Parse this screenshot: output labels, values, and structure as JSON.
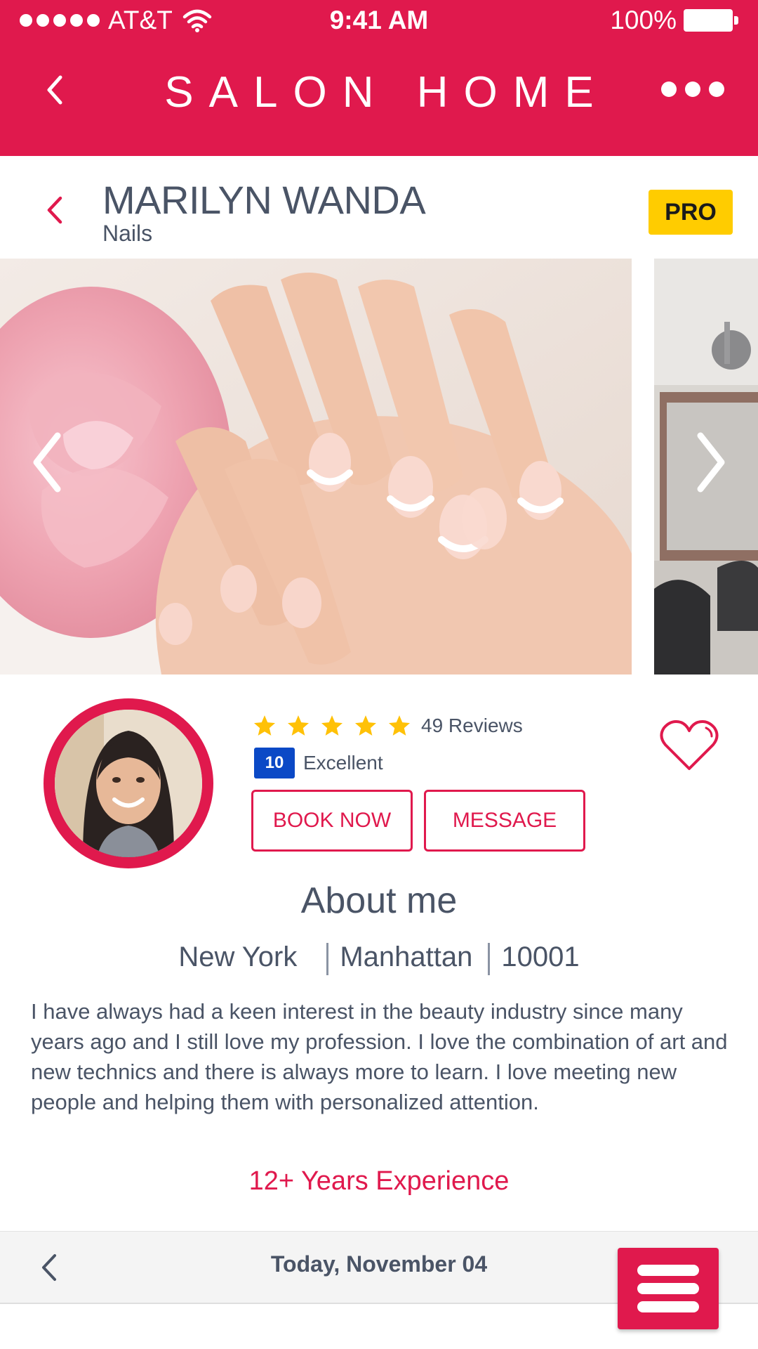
{
  "status_bar": {
    "carrier": "AT&T",
    "time": "9:41 AM",
    "battery": "100%"
  },
  "header": {
    "brand": "SALON HOME",
    "back_icon": "chevron-left-icon",
    "more_icon": "more-dots-icon"
  },
  "profile": {
    "name": "MARILYN WANDA",
    "category": "Nails",
    "badge": "PRO",
    "rating_stars": 5,
    "reviews": "49 Reviews",
    "score": "10",
    "score_label": "Excellent",
    "book_label": "BOOK NOW",
    "message_label": "MESSAGE"
  },
  "about": {
    "title": "About me",
    "city": "New York",
    "area": "Manhattan",
    "zip": "10001",
    "bio": "I have always had a keen interest in the beauty industry since many years ago and I still love my profession. I love the combination of art and new technics and there is always more to learn. I love meeting new people and helping them with personalized attention.",
    "experience": "12+ Years Experience"
  },
  "footer": {
    "date": "Today, November 04",
    "menu_icon": "hamburger-menu-icon"
  },
  "colors": {
    "brand": "#e0194d",
    "text": "#4a5466",
    "pro_badge": "#ffcc00",
    "score_badge": "#0b49c6",
    "star": "#ffc107"
  }
}
